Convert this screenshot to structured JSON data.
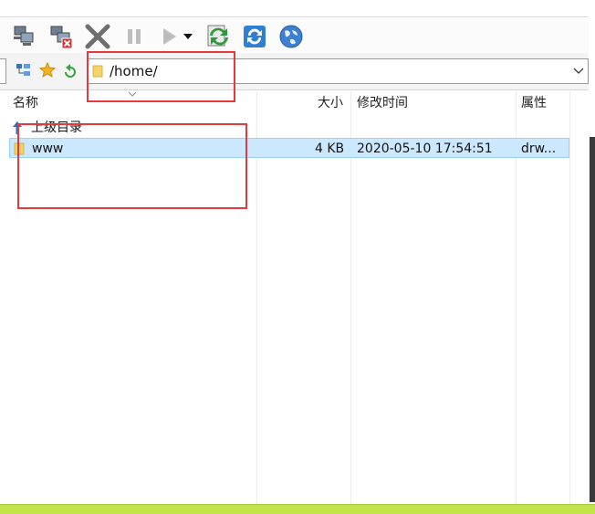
{
  "address": {
    "path": "/home/"
  },
  "columns": {
    "name": "名称",
    "size": "大小",
    "modified": "修改时间",
    "attrs": "属性"
  },
  "rows": [
    {
      "name": "上级目录",
      "size": "",
      "modified": "",
      "attrs": ""
    },
    {
      "name": "www",
      "size": "4 KB",
      "modified": "2020-05-10 17:54:51",
      "attrs": "drw..."
    }
  ],
  "colors": {
    "selection": "#cce8ff",
    "annotation": "#e5393b",
    "status": "#c3e34a"
  }
}
